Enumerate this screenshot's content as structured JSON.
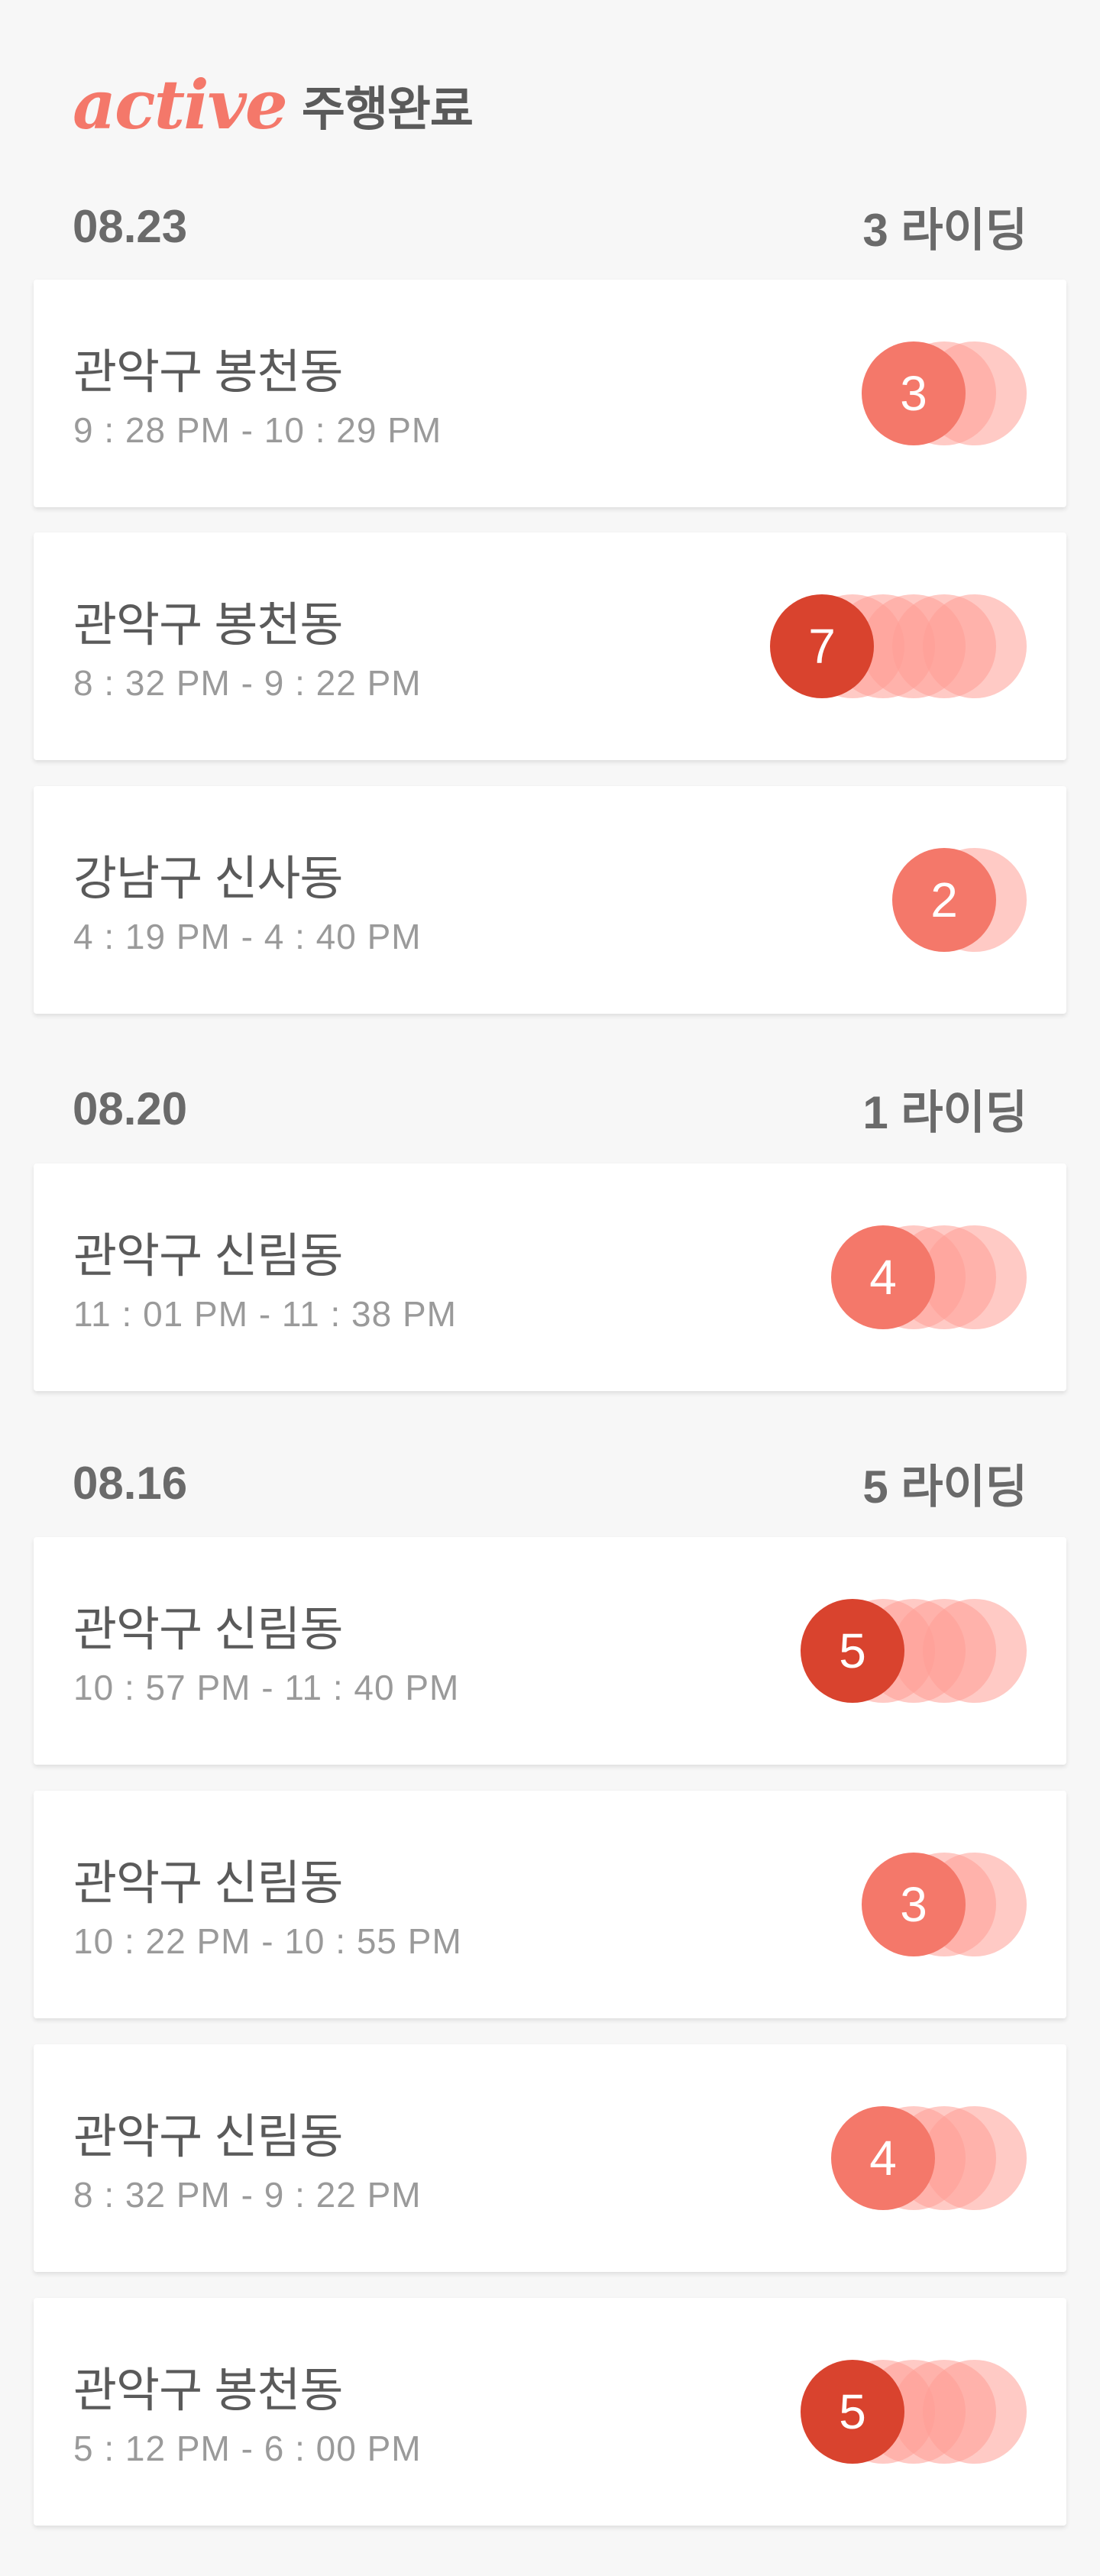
{
  "header": {
    "brand": "active",
    "subtitle": "주행완료"
  },
  "colors": {
    "brand": "#f4786a",
    "circle_light": "#ff9f95",
    "circle_mid": "#f4786a",
    "circle_dark": "#d9432e"
  },
  "groups": [
    {
      "date": "08.23",
      "count_label": "3 라이딩",
      "rides": [
        {
          "location": "관악구 봉천동",
          "time": "9 : 28 PM - 10 : 29 PM",
          "count": "3",
          "level": "mid"
        },
        {
          "location": "관악구 봉천동",
          "time": "8 : 32 PM - 9 : 22 PM",
          "count": "7",
          "level": "dark"
        },
        {
          "location": "강남구 신사동",
          "time": "4 : 19 PM - 4 : 40 PM",
          "count": "2",
          "level": "mid"
        }
      ]
    },
    {
      "date": "08.20",
      "count_label": "1 라이딩",
      "rides": [
        {
          "location": "관악구 신림동",
          "time": "11 : 01 PM - 11 : 38 PM",
          "count": "4",
          "level": "mid"
        }
      ]
    },
    {
      "date": "08.16",
      "count_label": "5 라이딩",
      "rides": [
        {
          "location": "관악구 신림동",
          "time": "10 : 57 PM - 11 : 40 PM",
          "count": "5",
          "level": "dark"
        },
        {
          "location": "관악구 신림동",
          "time": "10 : 22 PM - 10 : 55 PM",
          "count": "3",
          "level": "mid"
        },
        {
          "location": "관악구 신림동",
          "time": "8 : 32 PM - 9 : 22 PM",
          "count": "4",
          "level": "mid"
        },
        {
          "location": "관악구 봉천동",
          "time": "5 : 12 PM - 6 : 00 PM",
          "count": "5",
          "level": "dark"
        }
      ]
    }
  ]
}
